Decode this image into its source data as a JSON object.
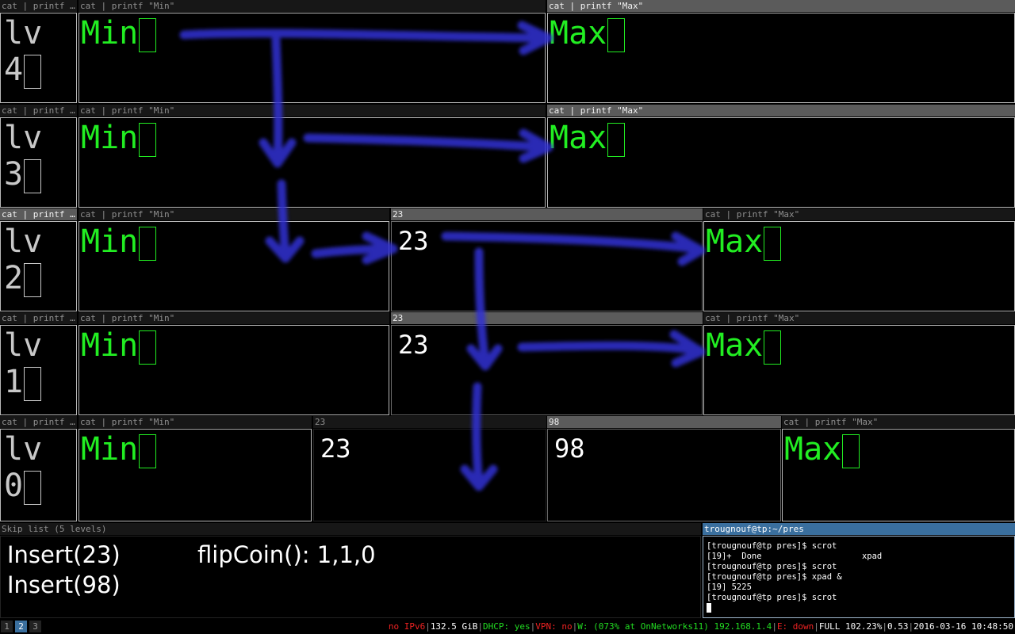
{
  "colors": {
    "green_text": "#22ee22",
    "arrow": "#3030d0",
    "active_title": "#5b5b5b",
    "workspace_active": "#3a6f9e"
  },
  "titles": {
    "cat_printf": "cat | printf …",
    "cat_min": "cat | printf \"Min\"",
    "cat_max": "cat | printf \"Max\"",
    "skip_list": "Skip list (5 levels)",
    "terminal": "trougnouf@tp:~/pres"
  },
  "levels": [
    {
      "label": "lv",
      "digit": "4"
    },
    {
      "label": "lv",
      "digit": "3"
    },
    {
      "label": "lv",
      "digit": "2"
    },
    {
      "label": "lv",
      "digit": "1"
    },
    {
      "label": "lv",
      "digit": "0"
    }
  ],
  "nodes": {
    "min": "Min",
    "max": "Max",
    "n23": "23",
    "n98": "98"
  },
  "info": {
    "line1": "Insert(23)",
    "line2": "Insert(98)",
    "flip": "flipCoin(): 1,1,0"
  },
  "terminal_lines": [
    "[trougnouf@tp pres]$ scrot",
    "[19]+  Done                    xpad",
    "[trougnouf@tp pres]$ scrot",
    "[trougnouf@tp pres]$ xpad &",
    "[19] 5225",
    "[trougnouf@tp pres]$ scrot"
  ],
  "workspaces": [
    "1",
    "2",
    "3"
  ],
  "status": {
    "ipv6": "no IPv6",
    "disk": "132.5 GiB",
    "dhcp": "DHCP: yes",
    "vpn": "VPN: no",
    "wifi": "W: (073% at OnNetworks11) 192.168.1.4",
    "eth": "E: down",
    "battery": "FULL 102.23%",
    "load": "0.53",
    "datetime": "2016-03-16 10:48:50"
  }
}
